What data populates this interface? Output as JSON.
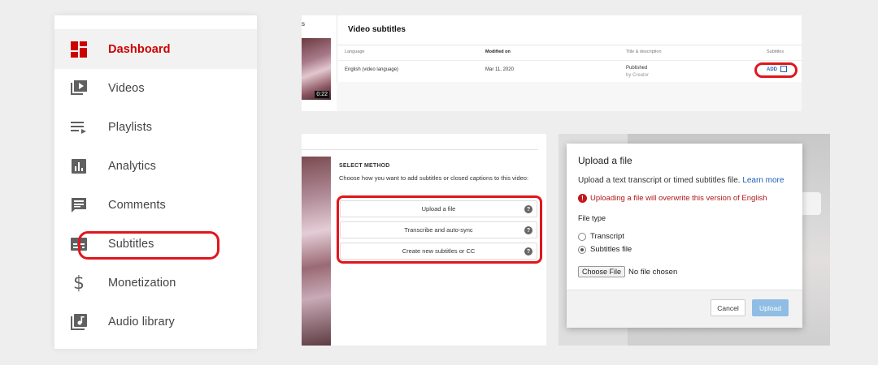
{
  "sidebar": {
    "items": [
      {
        "label": "Dashboard",
        "icon": "dashboard-icon"
      },
      {
        "label": "Videos",
        "icon": "videos-icon"
      },
      {
        "label": "Playlists",
        "icon": "playlists-icon"
      },
      {
        "label": "Analytics",
        "icon": "analytics-icon"
      },
      {
        "label": "Comments",
        "icon": "comments-icon"
      },
      {
        "label": "Subtitles",
        "icon": "subtitles-icon"
      },
      {
        "label": "Monetization",
        "icon": "dollar-icon"
      },
      {
        "label": "Audio library",
        "icon": "audio-library-icon"
      }
    ],
    "active": "Dashboard",
    "highlighted": "Subtitles"
  },
  "subtitles_table": {
    "thumb_label": "s",
    "duration": "0:22",
    "title": "Video subtitles",
    "columns": [
      "Language",
      "Modified on",
      "Title & description",
      "Subtitles"
    ],
    "row": {
      "language": "English (video language)",
      "modified": "Mar 11, 2020",
      "status": "Published",
      "status_by": "by Creator",
      "action": "ADD"
    }
  },
  "select_method": {
    "heading": "SELECT METHOD",
    "description": "Choose how you want to add subtitles or closed captions to this video:",
    "options": [
      "Upload a file",
      "Transcribe and auto-sync",
      "Create new subtitles or CC"
    ],
    "help": "?"
  },
  "upload_dialog": {
    "title": "Upload a file",
    "description": "Upload a text transcript or timed subtitles file.",
    "learn_more": "Learn more",
    "warning_icon": "!",
    "warning": "Uploading a file will overwrite this version of English",
    "file_type_label": "File type",
    "file_types": [
      "Transcript",
      "Subtitles file"
    ],
    "selected_type": "Subtitles file",
    "choose_file_label": "Choose File",
    "file_status": "No file chosen",
    "cancel_label": "Cancel",
    "upload_label": "Upload"
  },
  "colors": {
    "accent_red": "#cc0000",
    "highlight_ring": "#e0161c",
    "link_blue": "#1e5fb8",
    "upload_button": "#90bde3"
  }
}
